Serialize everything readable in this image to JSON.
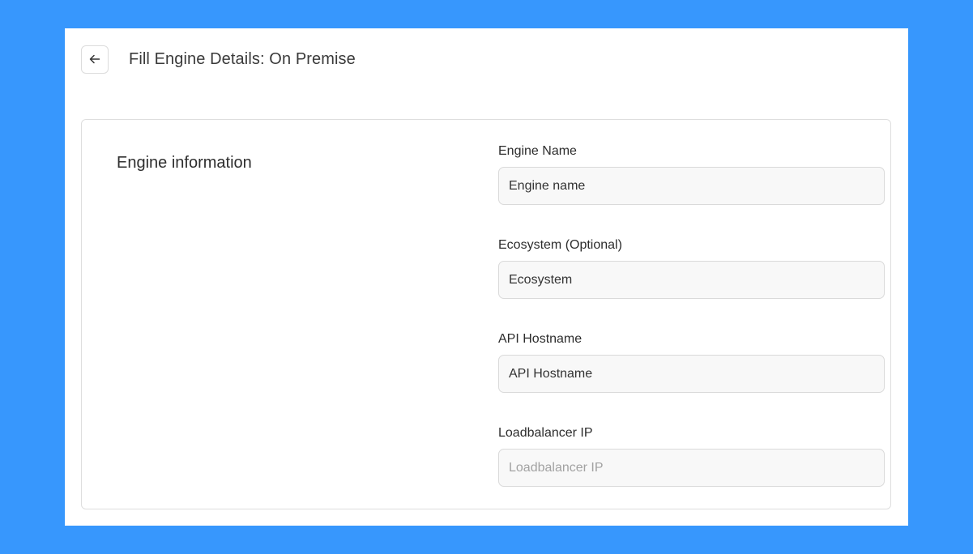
{
  "header": {
    "back_icon": "arrow-left-icon",
    "title": "Fill Engine Details: On Premise"
  },
  "section": {
    "title": "Engine information"
  },
  "fields": [
    {
      "label": "Engine Name",
      "value": "Engine name",
      "placeholder": ""
    },
    {
      "label": "Ecosystem (Optional)",
      "value": "Ecosystem",
      "placeholder": ""
    },
    {
      "label": "API Hostname",
      "value": "API Hostname",
      "placeholder": ""
    },
    {
      "label": "Loadbalancer IP",
      "value": "",
      "placeholder": "Loadbalancer IP"
    }
  ],
  "colors": {
    "background": "#3797fd",
    "panel": "#ffffff",
    "input_bg": "#f8f8f8",
    "border": "#dadada"
  }
}
